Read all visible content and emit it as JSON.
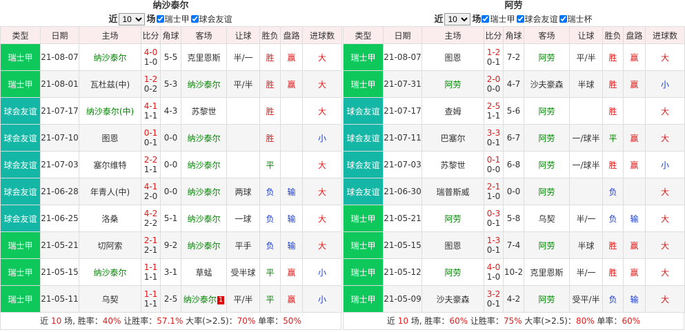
{
  "colors": {
    "league": "#0fc85c",
    "friendly": "#14b7a5",
    "red": "#e01b1b",
    "blue": "#1a3cd6",
    "green": "#008800"
  },
  "headers": [
    "类型",
    "日期",
    "主场",
    "比分",
    "角球",
    "客场",
    "让球",
    "胜负",
    "盘路",
    "进球数"
  ],
  "left": {
    "title": "纳沙泰尔",
    "filter": {
      "prefix": "近",
      "count": "10",
      "suffix": "场",
      "checks": [
        "瑞士甲",
        "球会友谊"
      ]
    },
    "rows": [
      {
        "type": "瑞士甲",
        "date": "21-08-07",
        "home": "纳沙泰尔",
        "ft": "4-0",
        "ht": "1-0",
        "corner": "5-5",
        "away": "克里恩斯",
        "hc": "半/一",
        "wl": "胜",
        "pan": "赢",
        "goals": "大"
      },
      {
        "type": "瑞士甲",
        "date": "21-08-01",
        "home": "瓦杜兹(中)",
        "ft": "1-2",
        "ht": "0-2",
        "corner": "5-3",
        "away": "纳沙泰尔",
        "hc": "平/半",
        "wl": "胜",
        "pan": "赢",
        "goals": "大"
      },
      {
        "type": "球会友谊",
        "date": "21-07-17",
        "home": "纳沙泰尔(中)",
        "ft": "4-1",
        "ht": "1-1",
        "corner": "4-3",
        "away": "苏黎世",
        "hc": "",
        "wl": "胜",
        "pan": "",
        "goals": "大"
      },
      {
        "type": "球会友谊",
        "date": "21-07-10",
        "home": "图恩",
        "ft": "0-1",
        "ht": "0-1",
        "corner": "0-0",
        "away": "纳沙泰尔",
        "hc": "",
        "wl": "胜",
        "pan": "",
        "goals": "小"
      },
      {
        "type": "球会友谊",
        "date": "21-07-03",
        "home": "塞尔维特",
        "ft": "2-2",
        "ht": "1-1",
        "corner": "0-0",
        "away": "纳沙泰尔",
        "hc": "",
        "wl": "平",
        "pan": "",
        "goals": "大"
      },
      {
        "type": "球会友谊",
        "date": "21-06-28",
        "home": "年青人(中)",
        "ft": "4-1",
        "ht": "2-0",
        "corner": "0-0",
        "away": "纳沙泰尔",
        "hc": "两球",
        "wl": "负",
        "pan": "输",
        "goals": "大"
      },
      {
        "type": "球会友谊",
        "date": "21-06-25",
        "home": "洛桑",
        "ft": "4-2",
        "ht": "2-2",
        "corner": "5-1",
        "away": "纳沙泰尔",
        "hc": "一球",
        "wl": "负",
        "pan": "输",
        "goals": "大"
      },
      {
        "type": "瑞士甲",
        "date": "21-05-21",
        "home": "切阿索",
        "ft": "2-1",
        "ht": "2-1",
        "corner": "9-2",
        "away": "纳沙泰尔",
        "hc": "平手",
        "wl": "负",
        "pan": "输",
        "goals": "大"
      },
      {
        "type": "瑞士甲",
        "date": "21-05-15",
        "home": "纳沙泰尔",
        "ft": "1-1",
        "ht": "1-1",
        "corner": "3-1",
        "away": "草蜢",
        "hc": "受半球",
        "wl": "平",
        "pan": "赢",
        "goals": "小"
      },
      {
        "type": "瑞士甲",
        "date": "21-05-11",
        "home": "乌契",
        "ft": "1-1",
        "ht": "1-1",
        "corner": "2-5",
        "away": "纳沙泰尔",
        "away_tag": "1",
        "hc": "平/半",
        "wl": "平",
        "pan": "赢",
        "goals": "小"
      }
    ],
    "footer": {
      "p1": "近 ",
      "n": "10",
      "p2": " 场, 胜率：",
      "win": "40%",
      "p3": " 让胜率：",
      "hcwin": "57.1%",
      "p4": " 大率(>2.5)：",
      "big": "70%",
      "p5": " 单率：",
      "odd": "50%"
    }
  },
  "right": {
    "title": "阿劳",
    "filter": {
      "prefix": "近",
      "count": "10",
      "suffix": "场",
      "checks": [
        "瑞士甲",
        "球会友谊",
        "瑞士杯"
      ]
    },
    "rows": [
      {
        "type": "瑞士甲",
        "date": "21-08-07",
        "home": "图恩",
        "ft": "1-2",
        "ht": "0-1",
        "corner": "7-2",
        "away": "阿劳",
        "hc": "平/半",
        "wl": "胜",
        "pan": "赢",
        "goals": "大"
      },
      {
        "type": "瑞士甲",
        "date": "21-07-31",
        "home": "阿劳",
        "ft": "2-0",
        "ht": "0-0",
        "corner": "4-7",
        "away": "沙夫豪森",
        "hc": "半球",
        "wl": "胜",
        "pan": "赢",
        "goals": "小"
      },
      {
        "type": "球会友谊",
        "date": "21-07-17",
        "home": "查姆",
        "ft": "2-5",
        "ht": "1-1",
        "corner": "5-6",
        "away": "阿劳",
        "hc": "",
        "wl": "胜",
        "pan": "",
        "goals": "大"
      },
      {
        "type": "球会友谊",
        "date": "21-07-11",
        "home": "巴塞尔",
        "ft": "3-3",
        "ht": "0-1",
        "corner": "6-7",
        "away": "阿劳",
        "hc": "一/球半",
        "wl": "平",
        "pan": "赢",
        "goals": "大"
      },
      {
        "type": "球会友谊",
        "date": "21-07-03",
        "home": "苏黎世",
        "ft": "0-1",
        "ht": "0-0",
        "corner": "6-8",
        "away": "阿劳",
        "hc": "一/球半",
        "wl": "胜",
        "pan": "赢",
        "goals": "小"
      },
      {
        "type": "球会友谊",
        "date": "21-06-30",
        "home": "瑞普斯威",
        "ft": "2-1",
        "ht": "1-0",
        "corner": "0-0",
        "away": "阿劳",
        "hc": "",
        "wl": "负",
        "pan": "",
        "goals": "大"
      },
      {
        "type": "瑞士甲",
        "date": "21-05-21",
        "home": "阿劳",
        "ft": "0-3",
        "ht": "0-1",
        "corner": "5-8",
        "away": "乌契",
        "hc": "半/一",
        "wl": "负",
        "pan": "输",
        "goals": "大"
      },
      {
        "type": "瑞士甲",
        "date": "21-05-15",
        "home": "图恩",
        "ft": "1-3",
        "ht": "0-1",
        "corner": "7-4",
        "away": "阿劳",
        "hc": "半球",
        "wl": "胜",
        "pan": "赢",
        "goals": "大"
      },
      {
        "type": "瑞士甲",
        "date": "21-05-12",
        "home": "阿劳",
        "ft": "4-0",
        "ht": "1-0",
        "corner": "10-2",
        "away": "克里恩斯",
        "hc": "半/一",
        "wl": "胜",
        "pan": "赢",
        "goals": "大"
      },
      {
        "type": "瑞士甲",
        "date": "21-05-09",
        "home": "沙夫豪森",
        "ft": "3-2",
        "ht": "0-1",
        "corner": "4-2",
        "away": "阿劳",
        "hc": "受平/半",
        "wl": "负",
        "pan": "输",
        "goals": "大"
      }
    ],
    "footer": {
      "p1": "近 ",
      "n": "10",
      "p2": " 场, 胜率：",
      "win": "60%",
      "p3": " 让胜率：",
      "hcwin": "75%",
      "p4": " 大率(>2.5)：",
      "big": "80%",
      "p5": " 单率：",
      "odd": "60%"
    }
  }
}
